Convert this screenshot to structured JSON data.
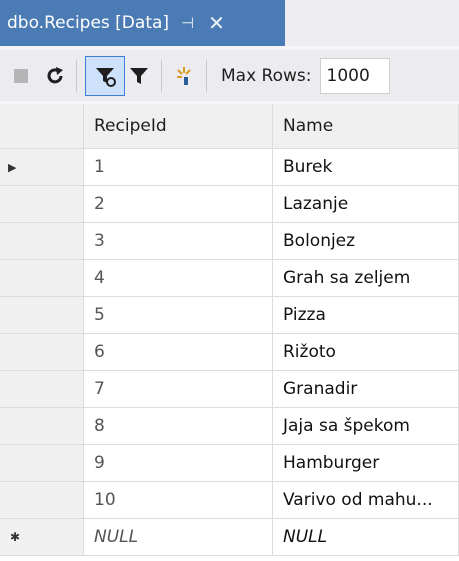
{
  "tab": {
    "title": "dbo.Recipes [Data]",
    "pin": "⊣",
    "close": "✕"
  },
  "toolbar": {
    "max_rows_label": "Max Rows:",
    "max_rows_value": "1000"
  },
  "grid": {
    "columns": [
      "RecipeId",
      "Name"
    ],
    "rows": [
      {
        "id": "1",
        "name": "Burek"
      },
      {
        "id": "2",
        "name": "Lazanje"
      },
      {
        "id": "3",
        "name": "Bolonjez"
      },
      {
        "id": "4",
        "name": "Grah sa zeljem"
      },
      {
        "id": "5",
        "name": "Pizza"
      },
      {
        "id": "6",
        "name": "Rižoto"
      },
      {
        "id": "7",
        "name": "Granadir"
      },
      {
        "id": "8",
        "name": "Jaja sa špekom"
      },
      {
        "id": "9",
        "name": "Hamburger"
      },
      {
        "id": "10",
        "name": "Varivo od mahu..."
      }
    ],
    "new_row": {
      "id": "NULL",
      "name": "NULL"
    },
    "current_row_indicator": "▶",
    "new_row_indicator": "✱"
  }
}
